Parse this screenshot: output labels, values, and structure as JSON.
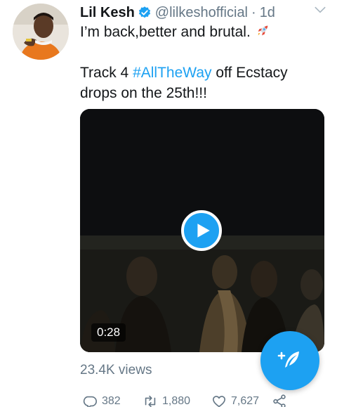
{
  "tweet": {
    "display_name": "Lil Kesh",
    "handle": "@lilkeshofficial",
    "separator": "·",
    "timestamp": "1d",
    "text_line1": "I’m back,better and brutal.",
    "text_line3_prefix": "Track 4 ",
    "hashtag": "#AllTheWay",
    "text_line3_suffix": " off Ecstacy",
    "text_line4": "drops on the 25th!!!",
    "media": {
      "duration": "0:28",
      "views": "23.4K views"
    },
    "counts": {
      "replies": "382",
      "retweets": "1,880",
      "likes": "7,627"
    }
  },
  "colors": {
    "accent": "#1da1f2",
    "secondary_text": "#657786"
  },
  "icons": {
    "verified": "verified-badge-icon",
    "caret": "chevron-down-icon",
    "emoji": "rocket-emoji",
    "play": "play-icon",
    "reply": "reply-icon",
    "retweet": "retweet-icon",
    "like": "heart-icon",
    "share": "share-icon",
    "compose": "compose-tweet-icon"
  }
}
